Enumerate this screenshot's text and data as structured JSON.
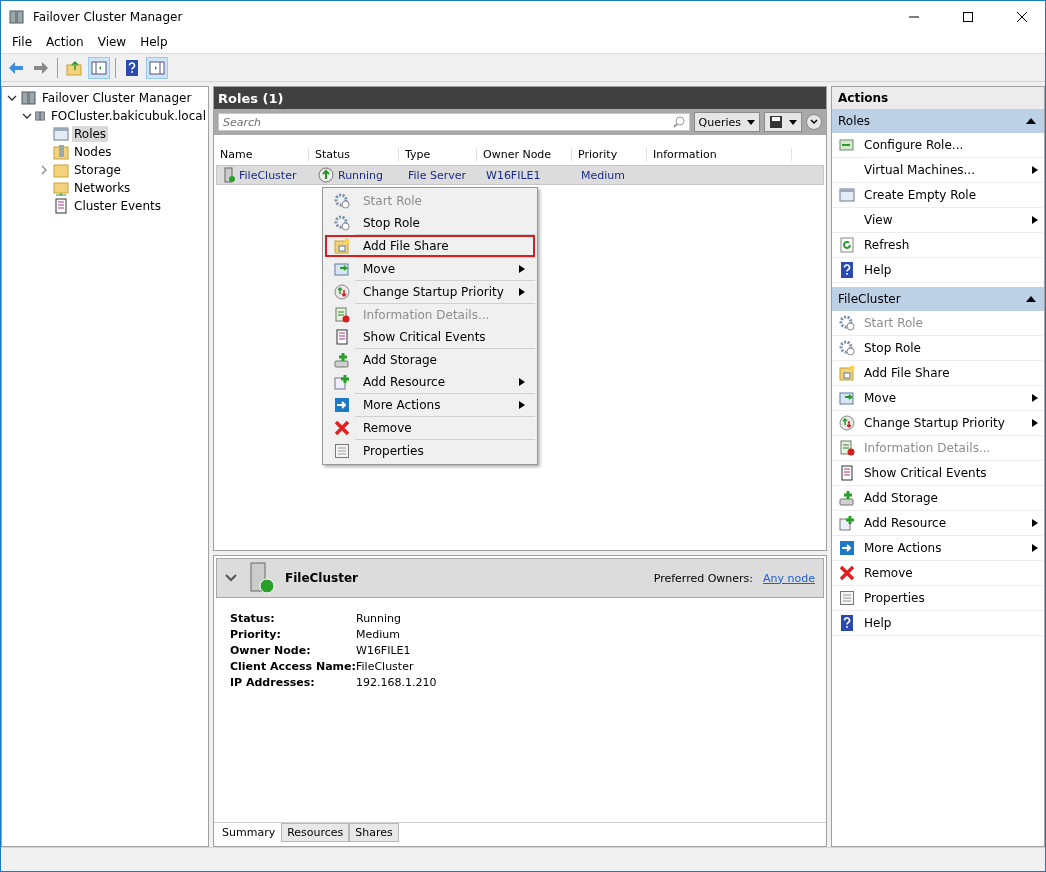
{
  "window": {
    "title": "Failover Cluster Manager"
  },
  "menu": [
    "File",
    "Action",
    "View",
    "Help"
  ],
  "toolbar": [
    {
      "pressed": false
    },
    {
      "pressed": false
    },
    {
      "pressed": false
    },
    {
      "pressed": true
    },
    {
      "pressed": false
    },
    {
      "pressed": true
    }
  ],
  "tree": [
    {
      "label": "Failover Cluster Manager",
      "selected": false,
      "expanded": true,
      "children": [
        {
          "label": "FOCluster.bakicubuk.local",
          "selected": false,
          "expanded": true,
          "children": [
            {
              "label": "Roles",
              "selected": true
            },
            {
              "label": "Nodes",
              "selected": false
            },
            {
              "label": "Storage",
              "selected": false,
              "expanded": false
            },
            {
              "label": "Networks",
              "selected": false
            },
            {
              "label": "Cluster Events",
              "selected": false
            }
          ]
        }
      ]
    }
  ],
  "roles": {
    "title": "Roles (1)",
    "search": {
      "placeholder": "Search"
    },
    "queries": "Queries",
    "columns": [
      "Name",
      "Status",
      "Type",
      "Owner Node",
      "Priority",
      "Information"
    ],
    "rows": [
      {
        "selected": true,
        "cells": [
          "FileCluster",
          "Running",
          "File Server",
          "W16FILE1",
          "Medium"
        ]
      }
    ]
  },
  "context_menu": [
    [
      {
        "label": "Start Role",
        "disabled": true,
        "submenu": false,
        "highlighted": false
      },
      {
        "label": "Stop Role",
        "disabled": false,
        "submenu": false,
        "highlighted": false
      }
    ],
    [
      {
        "label": "Add File Share",
        "disabled": false,
        "submenu": false,
        "highlighted": true
      }
    ],
    [
      {
        "label": "Move",
        "disabled": false,
        "submenu": true,
        "highlighted": false
      }
    ],
    [
      {
        "label": "Change Startup Priority",
        "disabled": false,
        "submenu": true,
        "highlighted": false
      }
    ],
    [
      {
        "label": "Information Details...",
        "disabled": true,
        "submenu": false,
        "highlighted": false
      },
      {
        "label": "Show Critical Events",
        "disabled": false,
        "submenu": false,
        "highlighted": false
      }
    ],
    [
      {
        "label": "Add Storage",
        "disabled": false,
        "submenu": false,
        "highlighted": false
      },
      {
        "label": "Add Resource",
        "disabled": false,
        "submenu": true,
        "highlighted": false
      }
    ],
    [
      {
        "label": "More Actions",
        "disabled": false,
        "submenu": true,
        "highlighted": false
      }
    ],
    [
      {
        "label": "Remove",
        "disabled": false,
        "submenu": false,
        "highlighted": false
      }
    ],
    [
      {
        "label": "Properties",
        "disabled": false,
        "submenu": false,
        "highlighted": false
      }
    ]
  ],
  "details": {
    "title": "FileCluster",
    "expanded": true,
    "preferred_owners_label": "Preferred Owners:",
    "preferred_owners_link": "Any node",
    "fields": [
      {
        "label": "Status:",
        "value": "Running"
      },
      {
        "label": "Priority:",
        "value": "Medium"
      },
      {
        "label": "Owner Node:",
        "value": "W16FILE1"
      },
      {
        "label": "Client Access Name:",
        "value": "FileCluster"
      },
      {
        "label": "IP Addresses:",
        "value": "192.168.1.210"
      }
    ],
    "tabs": [
      {
        "label": "Summary",
        "selected": true
      },
      {
        "label": "Resources",
        "selected": false
      },
      {
        "label": "Shares",
        "selected": false
      }
    ]
  },
  "actions": {
    "title": "Actions",
    "sections": [
      {
        "title": "Roles",
        "expanded": true,
        "items": [
          {
            "label": "Configure Role...",
            "disabled": false,
            "submenu": false
          },
          {
            "label": "Virtual Machines...",
            "disabled": false,
            "submenu": true
          },
          {
            "label": "Create Empty Role",
            "disabled": false,
            "submenu": false
          },
          {
            "label": "View",
            "disabled": false,
            "submenu": true
          },
          {
            "label": "Refresh",
            "disabled": false,
            "submenu": false
          },
          {
            "label": "Help",
            "disabled": false,
            "submenu": false
          }
        ]
      },
      {
        "title": "FileCluster",
        "expanded": true,
        "items": [
          {
            "label": "Start Role",
            "disabled": true,
            "submenu": false
          },
          {
            "label": "Stop Role",
            "disabled": false,
            "submenu": false
          },
          {
            "label": "Add File Share",
            "disabled": false,
            "submenu": false
          },
          {
            "label": "Move",
            "disabled": false,
            "submenu": true
          },
          {
            "label": "Change Startup Priority",
            "disabled": false,
            "submenu": true
          },
          {
            "label": "Information Details...",
            "disabled": true,
            "submenu": false
          },
          {
            "label": "Show Critical Events",
            "disabled": false,
            "submenu": false
          },
          {
            "label": "Add Storage",
            "disabled": false,
            "submenu": false
          },
          {
            "label": "Add Resource",
            "disabled": false,
            "submenu": true
          },
          {
            "label": "More Actions",
            "disabled": false,
            "submenu": true
          },
          {
            "label": "Remove",
            "disabled": false,
            "submenu": false
          },
          {
            "label": "Properties",
            "disabled": false,
            "submenu": false
          },
          {
            "label": "Help",
            "disabled": false,
            "submenu": false
          }
        ]
      }
    ]
  }
}
